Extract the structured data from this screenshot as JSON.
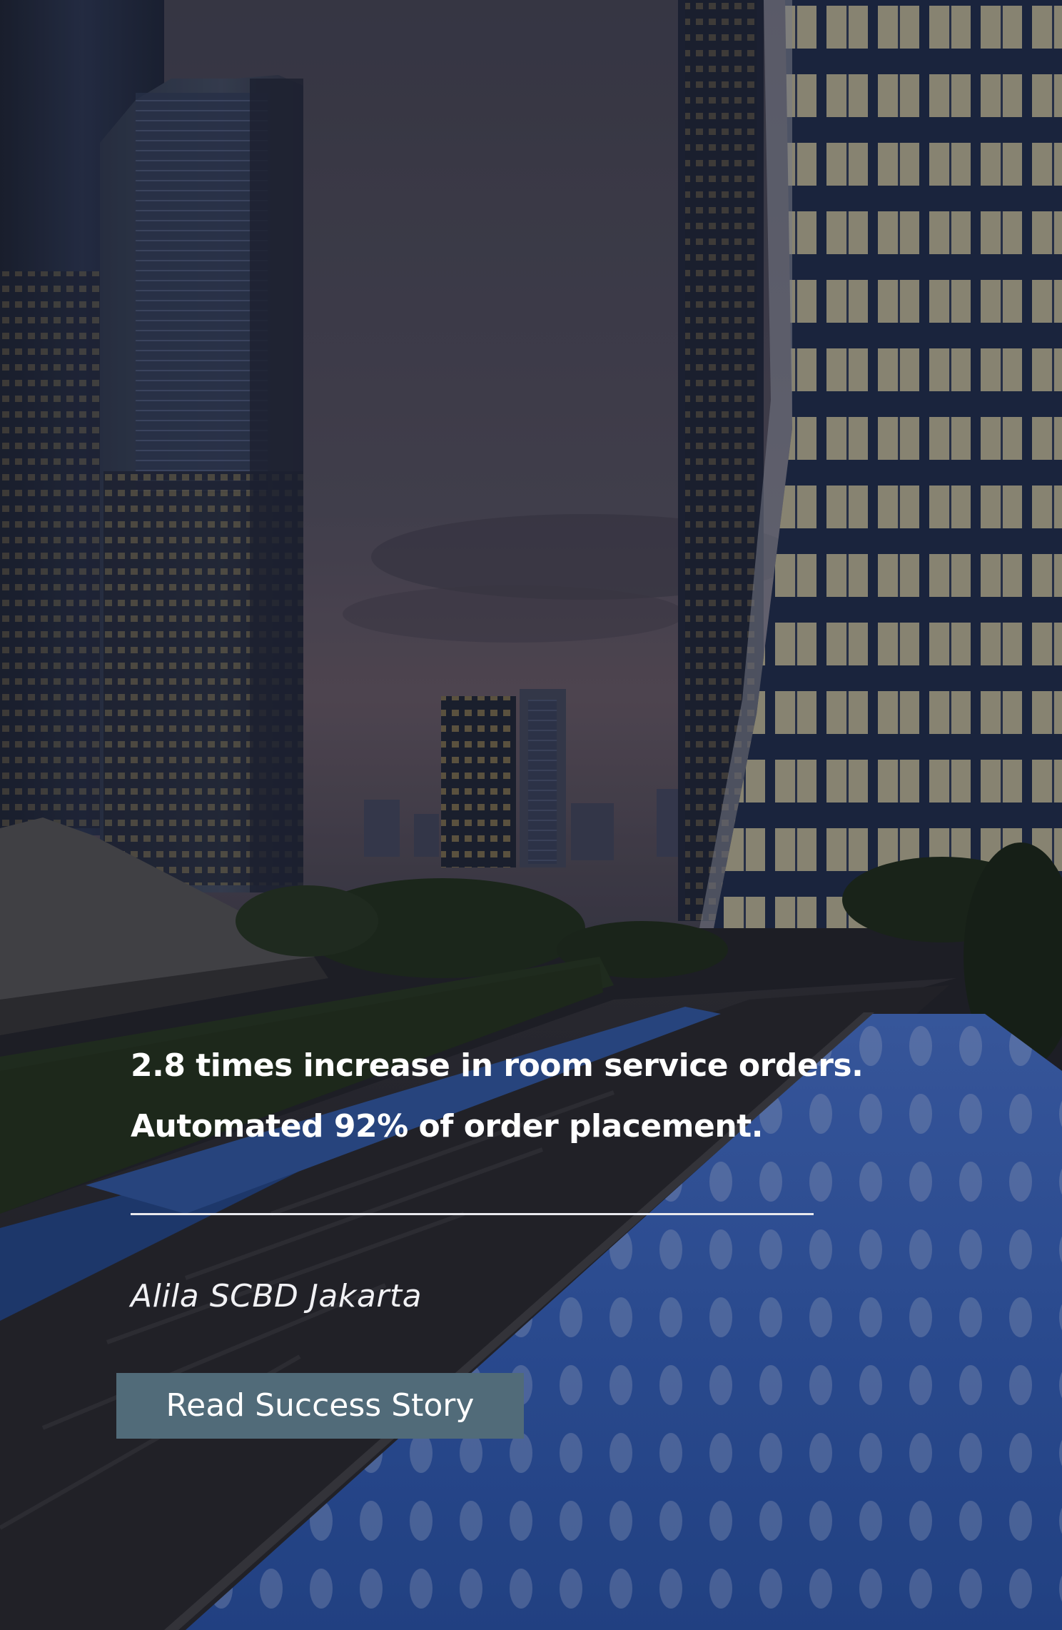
{
  "hero": {
    "headline_line1": "2.8 times increase in room service orders.",
    "headline_line2": "Automated 92% of order placement.",
    "property_name": "Alila SCBD Jakarta",
    "cta_label": "Read Success Story"
  },
  "colors": {
    "cta_background": "#516b79",
    "text": "#ffffff",
    "divider": "#e9e9ee"
  }
}
